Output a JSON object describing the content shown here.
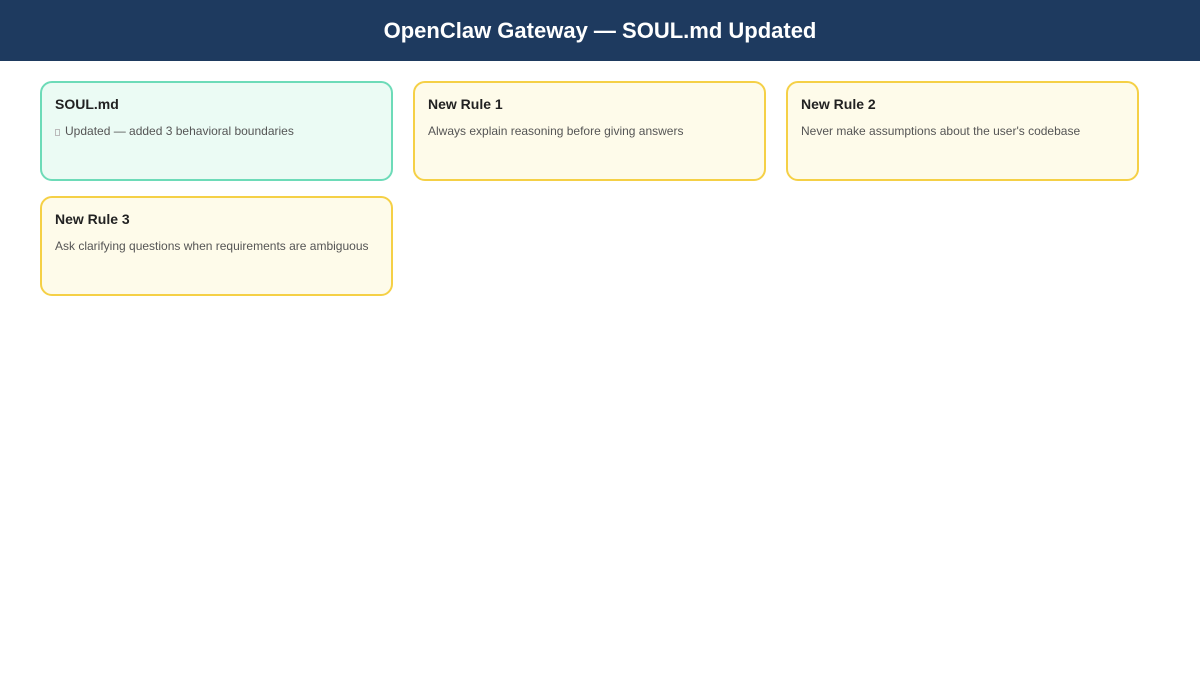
{
  "header": {
    "title": "OpenClaw Gateway — SOUL.md Updated"
  },
  "cards": [
    {
      "title": "SOUL.md",
      "text": "Updated — added 3 behavioral boundaries",
      "icon": "status-glyph-icon"
    },
    {
      "title": "New Rule 1",
      "text": "Always explain reasoning before giving answers"
    },
    {
      "title": "New Rule 2",
      "text": "Never make assumptions about the user's codebase"
    },
    {
      "title": "New Rule 3",
      "text": "Ask clarifying questions when requirements are ambiguous"
    }
  ],
  "colors": {
    "header_bg": "#1e3a5f",
    "status_border": "#6ddbb8",
    "status_bg": "#ebfbf4",
    "rule_border": "#f5d046",
    "rule_bg": "#fefbea"
  }
}
